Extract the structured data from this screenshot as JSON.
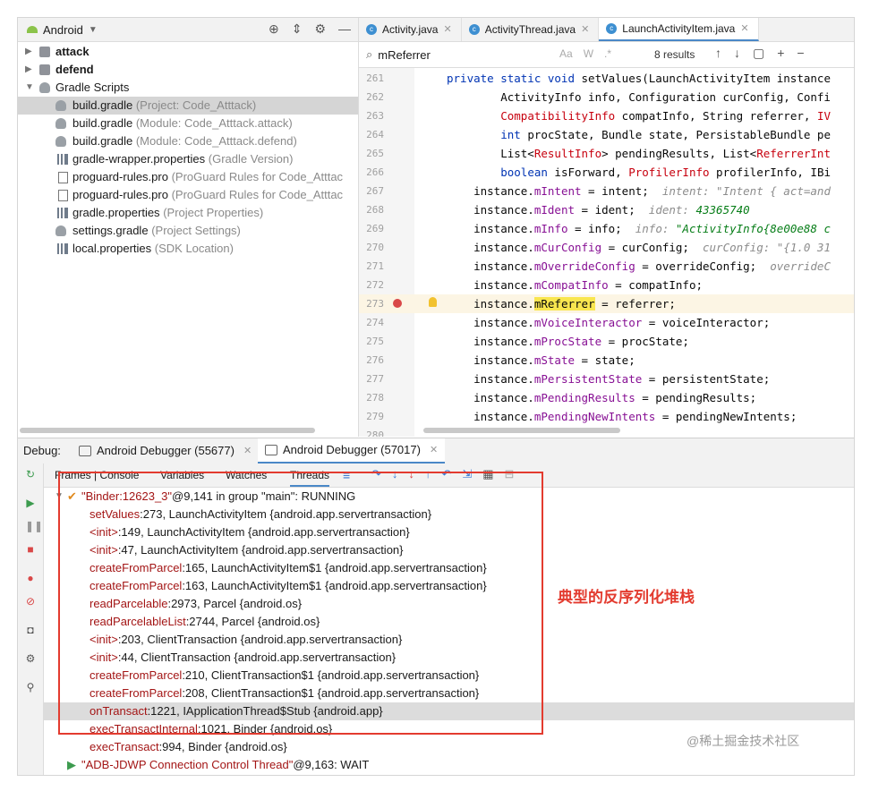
{
  "project": {
    "title": "Android",
    "tree": [
      {
        "name": "attack",
        "hint": "",
        "kind": "folder",
        "bold": true
      },
      {
        "name": "defend",
        "hint": "",
        "kind": "folder",
        "bold": true
      },
      {
        "name": "Gradle Scripts",
        "hint": "",
        "kind": "gradle-folder"
      },
      {
        "name": "build.gradle",
        "hint": "(Project: Code_Atttack)",
        "kind": "gradle"
      },
      {
        "name": "build.gradle",
        "hint": "(Module: Code_Atttack.attack)",
        "kind": "gradle"
      },
      {
        "name": "build.gradle",
        "hint": "(Module: Code_Atttack.defend)",
        "kind": "gradle"
      },
      {
        "name": "gradle-wrapper.properties",
        "hint": "(Gradle Version)",
        "kind": "props"
      },
      {
        "name": "proguard-rules.pro",
        "hint": "(ProGuard Rules for Code_Atttac",
        "kind": "file"
      },
      {
        "name": "proguard-rules.pro",
        "hint": "(ProGuard Rules for Code_Atttac",
        "kind": "file"
      },
      {
        "name": "gradle.properties",
        "hint": "(Project Properties)",
        "kind": "props"
      },
      {
        "name": "settings.gradle",
        "hint": "(Project Settings)",
        "kind": "gradle"
      },
      {
        "name": "local.properties",
        "hint": "(SDK Location)",
        "kind": "props"
      }
    ]
  },
  "editor": {
    "tabs": [
      "Activity.java",
      "ActivityThread.java",
      "LaunchActivityItem.java"
    ],
    "search_query": "mReferrer",
    "search_options": [
      "Aa",
      "W",
      ".*"
    ],
    "results": "8 results",
    "lines": [
      {
        "num": "261",
        "parts": [
          [
            "kw",
            "private static void "
          ],
          [
            "",
            "setValues(LaunchActivityItem instance"
          ]
        ]
      },
      {
        "num": "262",
        "parts": [
          [
            "",
            "        ActivityInfo info, Configuration curConfig, Confi"
          ]
        ]
      },
      {
        "num": "263",
        "parts": [
          [
            "",
            "        "
          ],
          [
            "typ",
            "CompatibilityInfo"
          ],
          [
            "",
            " compatInfo, String referrer, "
          ],
          [
            "typ",
            "IV"
          ]
        ]
      },
      {
        "num": "264",
        "parts": [
          [
            "",
            "        "
          ],
          [
            "kw",
            "int"
          ],
          [
            "",
            " procState, Bundle state, PersistableBundle pe"
          ]
        ]
      },
      {
        "num": "265",
        "parts": [
          [
            "",
            "        List<"
          ],
          [
            "typ",
            "ResultInfo"
          ],
          [
            "",
            "> pendingResults, List<"
          ],
          [
            "typ",
            "ReferrerInt"
          ]
        ]
      },
      {
        "num": "266",
        "parts": [
          [
            "",
            "        "
          ],
          [
            "kw",
            "boolean"
          ],
          [
            "",
            " isForward, "
          ],
          [
            "typ",
            "ProfilerInfo"
          ],
          [
            "",
            " profilerInfo, IBi"
          ]
        ]
      },
      {
        "num": "267",
        "parts": [
          [
            "",
            "    instance."
          ],
          [
            "fld",
            "mIntent"
          ],
          [
            "",
            " = intent;  "
          ],
          [
            "hint-c",
            "intent: \"Intent { act=and"
          ]
        ]
      },
      {
        "num": "268",
        "parts": [
          [
            "",
            "    instance."
          ],
          [
            "fld",
            "mIdent"
          ],
          [
            "",
            " = ident;  "
          ],
          [
            "hint-c",
            "ident: "
          ],
          [
            "hint-v",
            "43365740"
          ]
        ]
      },
      {
        "num": "269",
        "parts": [
          [
            "",
            "    instance."
          ],
          [
            "fld",
            "mInfo"
          ],
          [
            "",
            " = info;  "
          ],
          [
            "hint-c",
            "info: "
          ],
          [
            "hint-v",
            "\"ActivityInfo{8e00e88 c"
          ]
        ]
      },
      {
        "num": "270",
        "parts": [
          [
            "",
            "    instance."
          ],
          [
            "fld",
            "mCurConfig"
          ],
          [
            "",
            " = curConfig;  "
          ],
          [
            "hint-c",
            "curConfig: \"{1.0 31"
          ]
        ]
      },
      {
        "num": "271",
        "parts": [
          [
            "",
            "    instance."
          ],
          [
            "fld",
            "mOverrideConfig"
          ],
          [
            "",
            " = overrideConfig;  "
          ],
          [
            "hint-c",
            "overrideC"
          ]
        ]
      },
      {
        "num": "272",
        "parts": [
          [
            "",
            "    instance."
          ],
          [
            "fld",
            "mCompatInfo"
          ],
          [
            "",
            " = compatInfo;"
          ]
        ]
      },
      {
        "num": "273",
        "parts": [
          [
            "",
            "    instance."
          ],
          [
            "hl",
            "mReferrer"
          ],
          [
            "",
            " = referrer;"
          ]
        ]
      },
      {
        "num": "274",
        "parts": [
          [
            "",
            "    instance."
          ],
          [
            "fld",
            "mVoiceInteractor"
          ],
          [
            "",
            " = voiceInteractor;"
          ]
        ]
      },
      {
        "num": "275",
        "parts": [
          [
            "",
            "    instance."
          ],
          [
            "fld",
            "mProcState"
          ],
          [
            "",
            " = procState;"
          ]
        ]
      },
      {
        "num": "276",
        "parts": [
          [
            "",
            "    instance."
          ],
          [
            "fld",
            "mState"
          ],
          [
            "",
            " = state;"
          ]
        ]
      },
      {
        "num": "277",
        "parts": [
          [
            "",
            "    instance."
          ],
          [
            "fld",
            "mPersistentState"
          ],
          [
            "",
            " = persistentState;"
          ]
        ]
      },
      {
        "num": "278",
        "parts": [
          [
            "",
            "    instance."
          ],
          [
            "fld",
            "mPendingResults"
          ],
          [
            "",
            " = pendingResults;"
          ]
        ]
      },
      {
        "num": "279",
        "parts": [
          [
            "",
            "    instance."
          ],
          [
            "fld",
            "mPendingNewIntents"
          ],
          [
            "",
            " = pendingNewIntents;"
          ]
        ]
      },
      {
        "num": "280",
        "parts": [
          [
            "",
            ""
          ]
        ]
      }
    ]
  },
  "debug": {
    "label": "Debug:",
    "sessions": [
      "Android Debugger (55677)",
      "Android Debugger (57017)"
    ],
    "subtabs": [
      "Frames | Console",
      "Variables",
      "Watches",
      "Threads"
    ],
    "thread_running": {
      "name": "\"Binder:12623_3\"",
      "rest": "@9,141 in group \"main\": RUNNING"
    },
    "frames": [
      {
        "method": "setValues",
        "rest": ":273, LaunchActivityItem {android.app.servertransaction}"
      },
      {
        "method": "<init>",
        "rest": ":149, LaunchActivityItem {android.app.servertransaction}"
      },
      {
        "method": "<init>",
        "rest": ":47, LaunchActivityItem {android.app.servertransaction}"
      },
      {
        "method": "createFromParcel",
        "rest": ":165, LaunchActivityItem$1 {android.app.servertransaction}"
      },
      {
        "method": "createFromParcel",
        "rest": ":163, LaunchActivityItem$1 {android.app.servertransaction}"
      },
      {
        "method": "readParcelable",
        "rest": ":2973, Parcel {android.os}"
      },
      {
        "method": "readParcelableList",
        "rest": ":2744, Parcel {android.os}"
      },
      {
        "method": "<init>",
        "rest": ":203, ClientTransaction {android.app.servertransaction}"
      },
      {
        "method": "<init>",
        "rest": ":44, ClientTransaction {android.app.servertransaction}"
      },
      {
        "method": "createFromParcel",
        "rest": ":210, ClientTransaction$1 {android.app.servertransaction}"
      },
      {
        "method": "createFromParcel",
        "rest": ":208, ClientTransaction$1 {android.app.servertransaction}"
      },
      {
        "method": "onTransact",
        "rest": ":1221, IApplicationThread$Stub {android.app}"
      },
      {
        "method": "execTransactInternal",
        "rest": ":1021, Binder {android.os}"
      },
      {
        "method": "execTransact",
        "rest": ":994, Binder {android.os}"
      }
    ],
    "thread_wait": {
      "name": "\"ADB-JDWP Connection Control Thread\"",
      "rest": "@9,163: WAIT"
    }
  },
  "annotation": "典型的反序列化堆栈",
  "watermark": "@稀土掘金技术社区",
  "colors": {
    "accent": "#4a88c7",
    "annotation": "#e33b2f",
    "method": "#a31515"
  }
}
